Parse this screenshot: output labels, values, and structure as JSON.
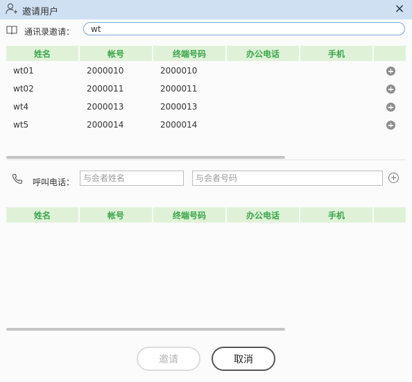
{
  "window": {
    "title": "邀请用户",
    "close_glyph": "×"
  },
  "search": {
    "label": "通讯录邀请：",
    "value": "wt"
  },
  "columns": [
    "姓名",
    "帐号",
    "终端号码",
    "办公电话",
    "手机",
    ""
  ],
  "results": [
    {
      "name": "wt01",
      "account": "2000010",
      "terminal": "2000010",
      "office": "",
      "mobile": ""
    },
    {
      "name": "wt02",
      "account": "2000011",
      "terminal": "2000011",
      "office": "",
      "mobile": ""
    },
    {
      "name": "wt4",
      "account": "2000013",
      "terminal": "2000013",
      "office": "",
      "mobile": ""
    },
    {
      "name": "wt5",
      "account": "2000014",
      "terminal": "2000014",
      "office": "",
      "mobile": ""
    }
  ],
  "call": {
    "label": "呼叫电话：",
    "name_placeholder": "与会者姓名",
    "number_placeholder": "与会者号码"
  },
  "invited_columns": [
    "姓名",
    "帐号",
    "终端号码",
    "办公电话",
    "手机",
    ""
  ],
  "buttons": {
    "invite": "邀请",
    "cancel": "取消"
  },
  "icons": {
    "title": "user-add-icon",
    "close": "close-icon",
    "contacts": "book-icon",
    "phone": "phone-icon",
    "row_add": "plus-circle-filled-icon",
    "add": "plus-circle-outline-icon"
  }
}
